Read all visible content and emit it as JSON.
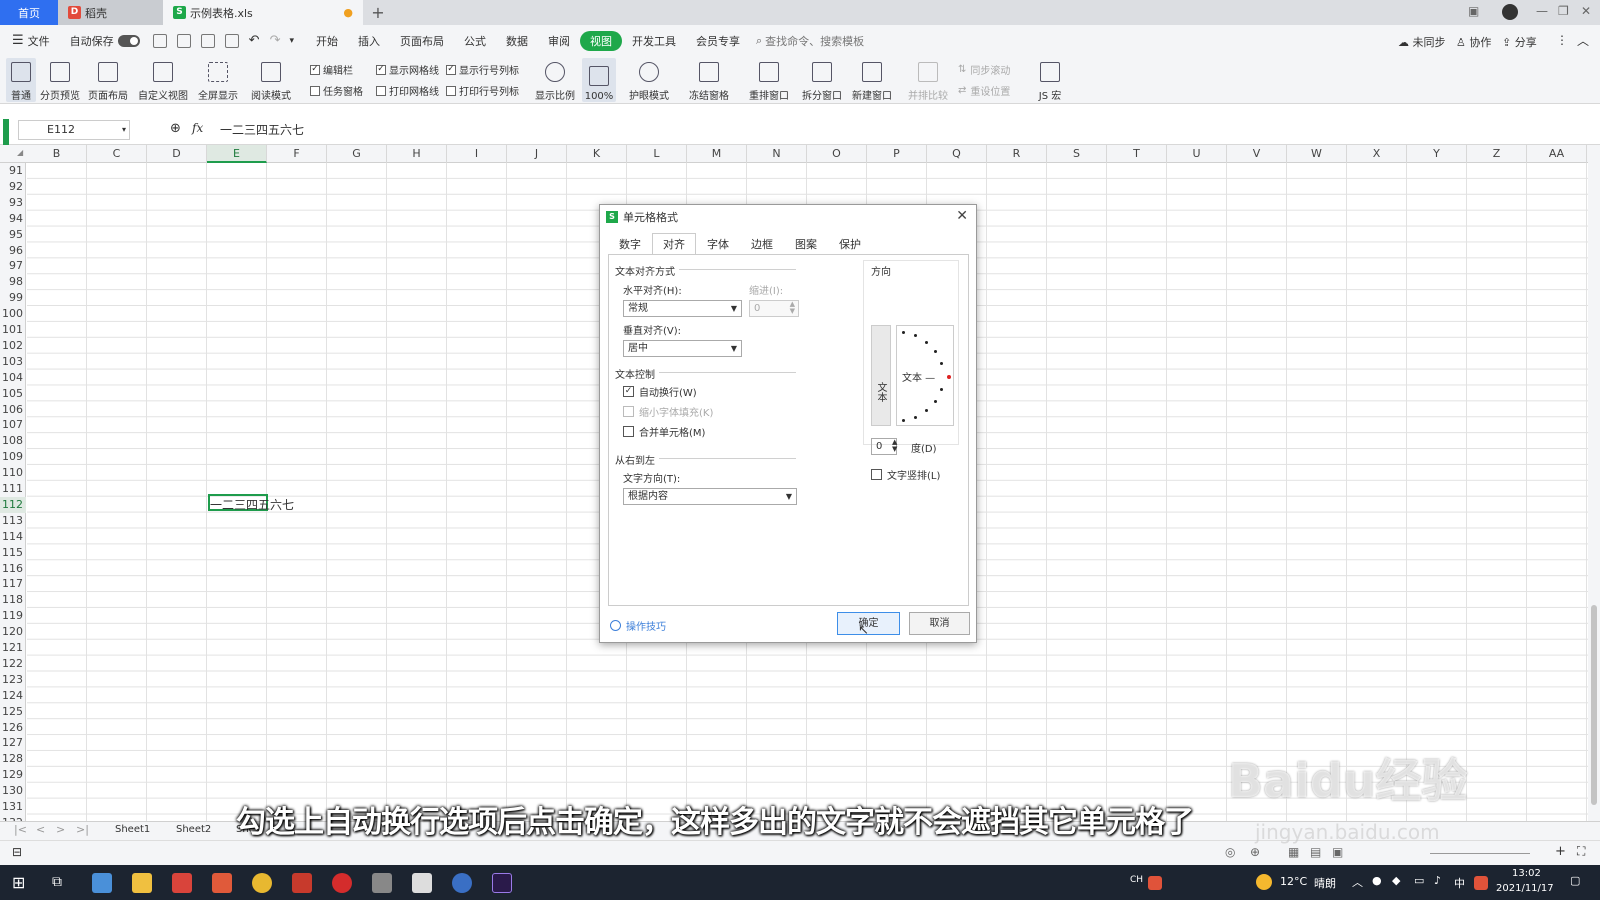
{
  "tabs": {
    "home": "首页",
    "straw": "稻壳",
    "file": "示例表格.xls",
    "plus": "+"
  },
  "menu": {
    "file": "文件",
    "autosave": "自动保存",
    "items": [
      "开始",
      "插入",
      "页面布局",
      "公式",
      "数据",
      "审阅",
      "视图",
      "开发工具",
      "会员专享"
    ],
    "active_index": 6,
    "search": "查找命令、搜索模板",
    "sync": "未同步",
    "collab": "协作",
    "share": "分享"
  },
  "ribbon": {
    "normal": "普通",
    "page_break": "分页预览",
    "page_layout": "页面布局",
    "custom_view": "自定义视图",
    "fullscreen": "全屏显示",
    "reading": "阅读模式",
    "chk_editbar": "编辑栏",
    "chk_taskpane": "任务窗格",
    "chk_gridlines": "显示网格线",
    "chk_print_grid": "打印网格线",
    "chk_headers": "显示行号列标",
    "chk_print_headers": "打印行号列标",
    "zoom": "显示比例",
    "zoom100": "100%",
    "eye": "护眼模式",
    "freeze": "冻结窗格",
    "arrange": "重排窗口",
    "split": "拆分窗口",
    "new_window": "新建窗口",
    "compare": "并排比较",
    "sync_scroll": "同步滚动",
    "reset_pos": "重设位置",
    "macro": "JS 宏"
  },
  "formula_bar": {
    "name_box": "E112",
    "fx": "fx",
    "content": "一二三四五六七"
  },
  "grid": {
    "columns": [
      "B",
      "C",
      "D",
      "E",
      "F",
      "G",
      "H",
      "I",
      "J",
      "K",
      "L",
      "M",
      "N",
      "O",
      "P",
      "Q",
      "R",
      "S",
      "T",
      "U",
      "V",
      "W",
      "X",
      "Y",
      "Z",
      "AA"
    ],
    "rows": [
      "91",
      "92",
      "93",
      "94",
      "95",
      "96",
      "97",
      "98",
      "99",
      "100",
      "101",
      "102",
      "103",
      "104",
      "105",
      "106",
      "107",
      "108",
      "109",
      "110",
      "111",
      "112",
      "113",
      "114",
      "115",
      "116",
      "117",
      "118",
      "119",
      "120",
      "121",
      "122",
      "123",
      "124",
      "125",
      "126",
      "127",
      "128",
      "129",
      "130",
      "131",
      "132"
    ],
    "cell_text": "一二三四五六七"
  },
  "sheets": [
    "Sheet1",
    "Sheet2",
    "She"
  ],
  "dialog": {
    "title": "单元格格式",
    "tabs": [
      "数字",
      "对齐",
      "字体",
      "边框",
      "图案",
      "保护"
    ],
    "active_tab": 1,
    "sect_text_align": "文本对齐方式",
    "h_align_label": "水平对齐(H):",
    "h_align_value": "常规",
    "indent_label": "缩进(I):",
    "indent_value": "0",
    "v_align_label": "垂直对齐(V):",
    "v_align_value": "居中",
    "sect_text_control": "文本控制",
    "wrap": "自动换行(W)",
    "wrap_checked": true,
    "shrink": "缩小字体填充(K)",
    "merge": "合并单元格(M)",
    "sect_rtl": "从右到左",
    "text_dir_label": "文字方向(T):",
    "text_dir_value": "根据内容",
    "sect_orient": "方向",
    "vertical_text": "文本",
    "orient_text": "文本 —",
    "degree_value": "0",
    "degree_label": "度(D)",
    "vertical_layout": "文字竖排(L)",
    "tips": "操作技巧",
    "ok": "确定",
    "cancel": "取消"
  },
  "taskbar": {
    "temp": "12°C",
    "weather": "晴朗",
    "ime": "中",
    "time": "13:02",
    "date": "2021/11/17"
  },
  "subtitle": "勾选上自动换行选项后点击确定，这样多出的文字就不会遮挡其它单元格了",
  "watermark": "Baidu经验",
  "watermark_url": "jingyan.baidu.com"
}
